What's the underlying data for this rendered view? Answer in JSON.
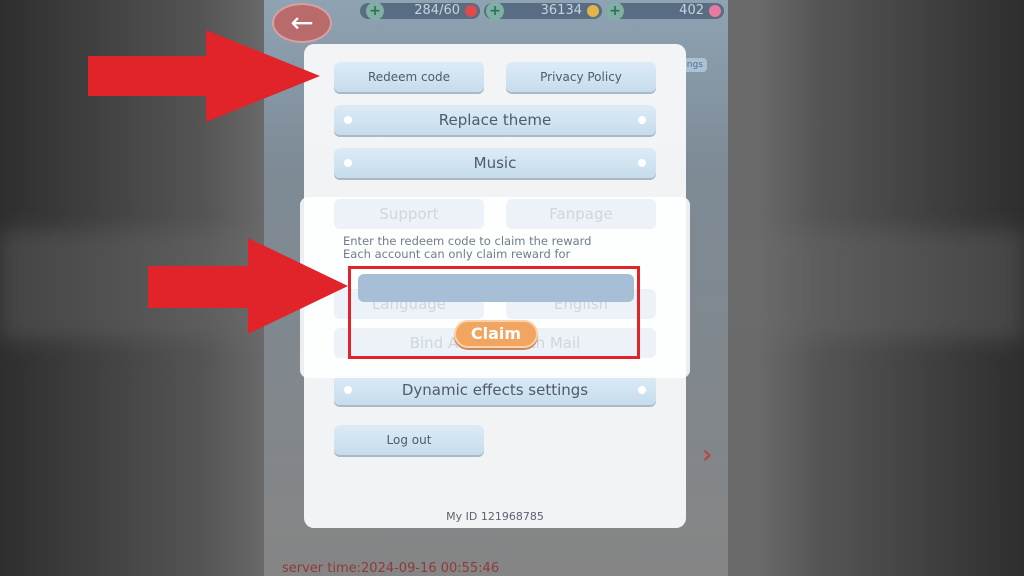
{
  "topbar": {
    "hearts": "284/60",
    "coins": "36134",
    "gems": "402",
    "settings_tab": "Settings"
  },
  "settings": {
    "redeem_code": "Redeem code",
    "privacy_policy": "Privacy Policy",
    "replace_theme": "Replace theme",
    "music": "Music",
    "support": "Support",
    "fanpage": "Fanpage",
    "language": "Language",
    "language_value": "English",
    "bind_mail": "Bind Account with Mail",
    "dynamic_effects": "Dynamic effects settings",
    "log_out": "Log out",
    "my_id": "My ID 121968785"
  },
  "redeem_dialog": {
    "line1": "Enter the redeem code to claim the reward",
    "line2": "Each account can only claim reward for",
    "code_value": "",
    "claim": "Claim"
  },
  "background": {
    "server_time": "server time:2024-09-16 00:55:46"
  },
  "colors": {
    "annotation_red": "#e0242a",
    "claim_orange": "#f1a560"
  }
}
